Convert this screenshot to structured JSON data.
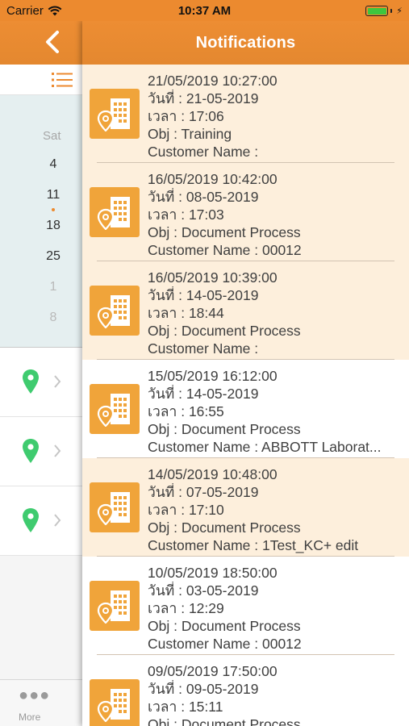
{
  "status_bar": {
    "carrier": "Carrier",
    "time": "10:37 AM"
  },
  "header": {
    "title": "Notifications"
  },
  "calendar": {
    "headers": [
      "i",
      "Sat"
    ],
    "saturday_dates": [
      "4",
      "11",
      "18",
      "25",
      "1",
      "8"
    ]
  },
  "tab_bar": {
    "more_label": "More"
  },
  "notifications": [
    {
      "timestamp": "21/05/2019 10:27:00",
      "date_line": "วันที่ : 21-05-2019",
      "time_line": "เวลา : 17:06",
      "obj_line": "Obj : Training",
      "customer_line": "Customer Name :",
      "read": false
    },
    {
      "timestamp": "16/05/2019 10:42:00",
      "date_line": "วันที่ : 08-05-2019",
      "time_line": "เวลา : 17:03",
      "obj_line": "Obj : Document Process",
      "customer_line": "Customer Name : 00012",
      "read": false
    },
    {
      "timestamp": "16/05/2019 10:39:00",
      "date_line": "วันที่ : 14-05-2019",
      "time_line": "เวลา : 18:44",
      "obj_line": "Obj : Document Process",
      "customer_line": "Customer Name :",
      "read": false
    },
    {
      "timestamp": "15/05/2019 16:12:00",
      "date_line": "วันที่ : 14-05-2019",
      "time_line": "เวลา : 16:55",
      "obj_line": "Obj : Document Process",
      "customer_line": "Customer Name : ABBOTT  Laborat...",
      "read": true
    },
    {
      "timestamp": "14/05/2019 10:48:00",
      "date_line": "วันที่ : 07-05-2019",
      "time_line": "เวลา : 17:10",
      "obj_line": "Obj : Document Process",
      "customer_line": "Customer Name : 1Test_KC+ edit",
      "read": false
    },
    {
      "timestamp": "10/05/2019 18:50:00",
      "date_line": "วันที่ : 03-05-2019",
      "time_line": "เวลา : 12:29",
      "obj_line": "Obj : Document Process",
      "customer_line": "Customer Name : 00012",
      "read": true
    },
    {
      "timestamp": "09/05/2019 17:50:00",
      "date_line": "วันที่ : 09-05-2019",
      "time_line": "เวลา : 15:11",
      "obj_line": "Obj : Document Process",
      "customer_line": "",
      "read": true
    }
  ],
  "colors": {
    "accent": "#ec8a2f",
    "unread_bg": "#fdefdc",
    "icon_bg": "#f0a43a",
    "pin_green": "#3fcb6f"
  },
  "icons": [
    "wifi-icon",
    "battery-icon",
    "back-chevron-icon",
    "list-icon",
    "location-pin-icon",
    "chevron-right-icon",
    "building-location-icon",
    "more-dots-icon"
  ]
}
